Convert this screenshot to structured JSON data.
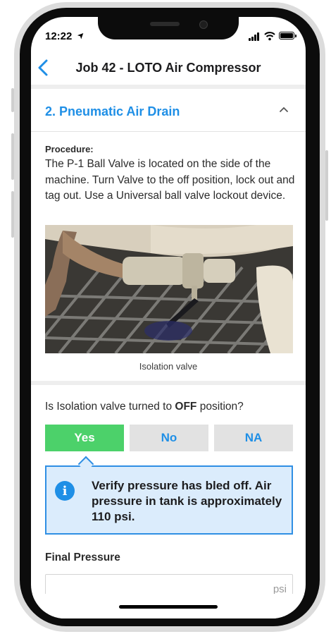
{
  "status_bar": {
    "time": "12:22",
    "location_arrow": "➤"
  },
  "nav": {
    "title": "Job 42 - LOTO Air Compressor",
    "back_icon": "chevron-left-icon"
  },
  "section": {
    "title": "2. Pneumatic Air Drain",
    "collapse_icon": "chevron-up-icon"
  },
  "procedure": {
    "label": "Procedure:",
    "text": "The P-1 Ball Valve is located on the side of the machine. Turn Valve to the off position, lock out and tag out. Use a Universal ball valve lockout device."
  },
  "photo": {
    "caption": "Isolation valve"
  },
  "question": {
    "prefix": "Is Isolation valve turned to ",
    "emphasis": "OFF",
    "suffix": " position?"
  },
  "choices": {
    "yes": "Yes",
    "no": "No",
    "na": "NA",
    "selected": "Yes"
  },
  "callout": {
    "icon": "info-icon",
    "text": "Verify pressure has bled off. Air pressure in tank is approximately 110 psi."
  },
  "final_pressure": {
    "label": "Final Pressure",
    "value": "",
    "unit": "psi"
  },
  "colors": {
    "accent": "#1f8fe6",
    "success": "#4cd16a",
    "callout_bg": "#dbecfc",
    "inactive": "#e2e2e2"
  }
}
